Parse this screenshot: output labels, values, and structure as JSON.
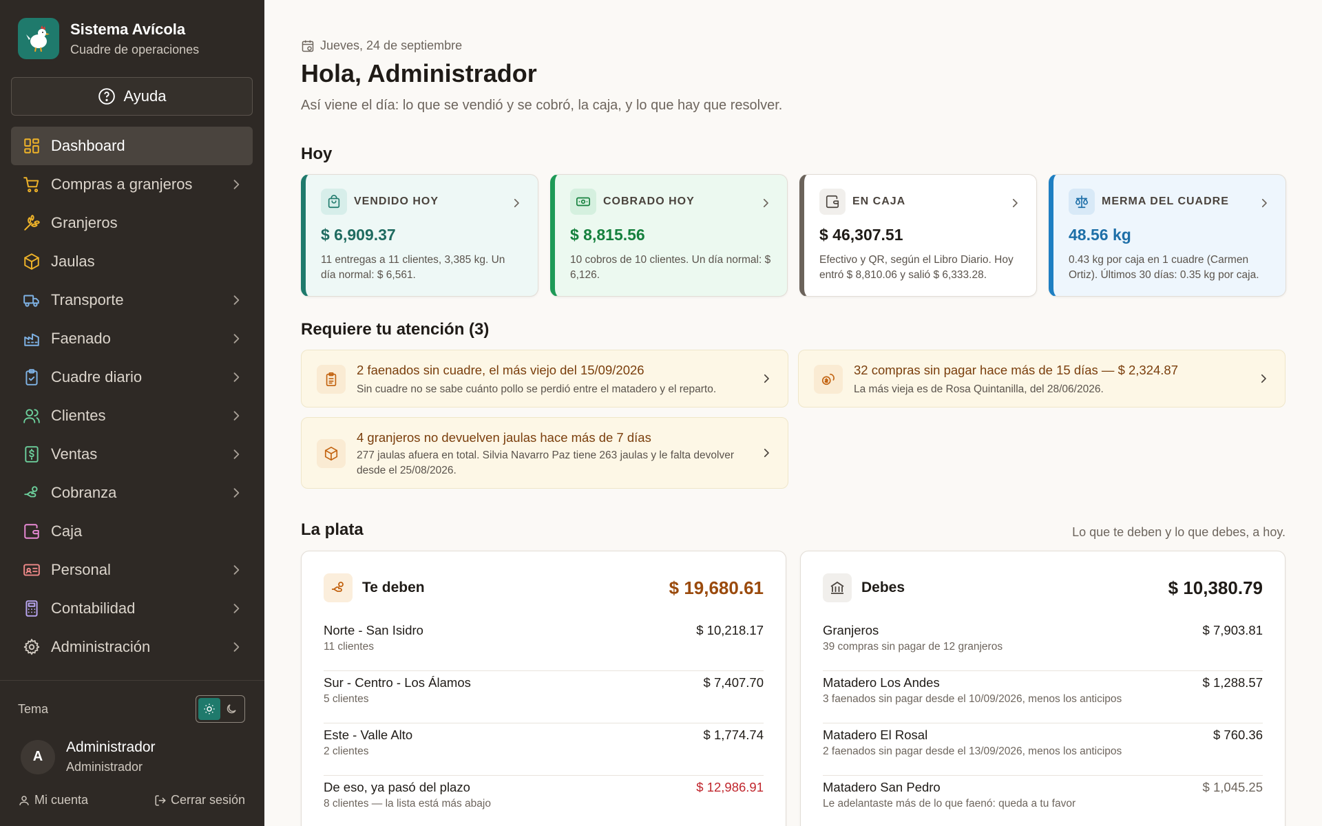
{
  "brand": {
    "title": "Sistema Avícola",
    "subtitle": "Cuadre de operaciones"
  },
  "help": {
    "label": "Ayuda"
  },
  "nav": [
    {
      "label": "Dashboard",
      "icon": "dashboard-icon",
      "active": true,
      "chevron": false
    },
    {
      "label": "Compras a granjeros",
      "icon": "cart-icon",
      "chevron": true
    },
    {
      "label": "Granjeros",
      "icon": "wheat-icon",
      "chevron": false
    },
    {
      "label": "Jaulas",
      "icon": "box-icon",
      "chevron": false
    },
    {
      "label": "Transporte",
      "icon": "truck-icon",
      "chevron": true
    },
    {
      "label": "Faenado",
      "icon": "factory-icon",
      "chevron": true
    },
    {
      "label": "Cuadre diario",
      "icon": "clipboard-check-icon",
      "chevron": true
    },
    {
      "label": "Clientes",
      "icon": "users-icon",
      "chevron": true
    },
    {
      "label": "Ventas",
      "icon": "receipt-icon",
      "chevron": true
    },
    {
      "label": "Cobranza",
      "icon": "hand-coins-icon",
      "chevron": true
    },
    {
      "label": "Caja",
      "icon": "wallet-icon",
      "chevron": false
    },
    {
      "label": "Personal",
      "icon": "id-card-icon",
      "chevron": true
    },
    {
      "label": "Contabilidad",
      "icon": "calculator-icon",
      "chevron": true
    },
    {
      "label": "Administración",
      "icon": "gear-icon",
      "chevron": true
    }
  ],
  "theme": {
    "label": "Tema"
  },
  "user": {
    "initial": "A",
    "name": "Administrador",
    "role": "Administrador",
    "account": "Mi cuenta",
    "logout": "Cerrar sesión"
  },
  "header": {
    "date": "Jueves, 24 de septiembre",
    "greeting": "Hola, Administrador",
    "subtitle": "Así viene el día: lo que se vendió y se cobró, la caja, y lo que hay que resolver."
  },
  "today": {
    "title": "Hoy",
    "cards": [
      {
        "label": "VENDIDO HOY",
        "value": "$ 6,909.37",
        "desc": "11 entregas a 11 clientes, 3,385 kg. Un día normal: $ 6,561.",
        "accent": "#1f7a6c",
        "bg": "#eef8f6",
        "value_color": "#1f6b60",
        "icon": "shopping-bag-icon"
      },
      {
        "label": "COBRADO HOY",
        "value": "$ 8,815.56",
        "desc": "10 cobros de 10 clientes. Un día normal: $ 6,126.",
        "accent": "#1e9a57",
        "bg": "#ecf9f0",
        "value_color": "#15803d",
        "icon": "banknote-icon"
      },
      {
        "label": "EN CAJA",
        "value": "$ 46,307.51",
        "desc": "Efectivo y QR, según el Libro Diario. Hoy entró $ 8,810.06 y salió $ 6,333.28.",
        "accent": "#6b635b",
        "bg": "#ffffff",
        "value_color": "#1f1b17",
        "icon": "wallet-icon"
      },
      {
        "label": "MERMA DEL CUADRE",
        "value": "48.56 kg",
        "desc": "0.43 kg por caja en 1 cuadre (Carmen Ortiz). Últimos 30 días: 0.35 kg por caja.",
        "accent": "#1e7fc2",
        "bg": "#eef6fd",
        "value_color": "#1e6fa8",
        "icon": "scale-icon"
      }
    ]
  },
  "attention": {
    "title": "Requiere tu atención (3)",
    "items": [
      {
        "title": "2 faenados sin cuadre, el más viejo del 15/09/2026",
        "desc": "Sin cuadre no se sabe cuánto pollo se perdió entre el matadero y el reparto.",
        "icon": "clipboard-icon"
      },
      {
        "title": "32 compras sin pagar hace más de 15 días — $ 2,324.87",
        "desc": "La más vieja es de Rosa Quintanilla, del 28/06/2026.",
        "icon": "coins-icon"
      },
      {
        "title": "4 granjeros no devuelven jaulas hace más de 7 días",
        "desc": "277 jaulas afuera en total. Silvia Navarro Paz tiene 263 jaulas y le falta devolver desde el 25/08/2026.",
        "icon": "box-icon"
      }
    ]
  },
  "money": {
    "title": "La plata",
    "note": "Lo que te deben y lo que debes, a hoy.",
    "owed": {
      "title": "Te deben",
      "total": "$ 19,680.61",
      "total_color": "#9a4a0c",
      "rows": [
        {
          "name": "Norte - San Isidro",
          "sub": "11 clientes",
          "amount": "$ 10,218.17",
          "color": "#1f1b17"
        },
        {
          "name": "Sur - Centro - Los Álamos",
          "sub": "5 clientes",
          "amount": "$ 7,407.70",
          "color": "#1f1b17"
        },
        {
          "name": "Este - Valle Alto",
          "sub": "2 clientes",
          "amount": "$ 1,774.74",
          "color": "#1f1b17"
        },
        {
          "name": "De eso, ya pasó del plazo",
          "sub": "8 clientes — la lista está más abajo",
          "amount": "$ 12,986.91",
          "color": "#c0262d"
        }
      ]
    },
    "debts": {
      "title": "Debes",
      "total": "$ 10,380.79",
      "total_color": "#1f1b17",
      "rows": [
        {
          "name": "Granjeros",
          "sub": "39 compras sin pagar de 12 granjeros",
          "amount": "$ 7,903.81",
          "color": "#1f1b17"
        },
        {
          "name": "Matadero Los Andes",
          "sub": "3 faenados sin pagar desde el 10/09/2026, menos los anticipos",
          "amount": "$ 1,288.57",
          "color": "#1f1b17"
        },
        {
          "name": "Matadero El Rosal",
          "sub": "2 faenados sin pagar desde el 13/09/2026, menos los anticipos",
          "amount": "$ 760.36",
          "color": "#1f1b17"
        },
        {
          "name": "Matadero San Pedro",
          "sub": "Le adelantaste más de lo que faenó: queda a tu favor",
          "amount": "$ 1,045.25",
          "color": "#6d655d"
        }
      ]
    }
  }
}
